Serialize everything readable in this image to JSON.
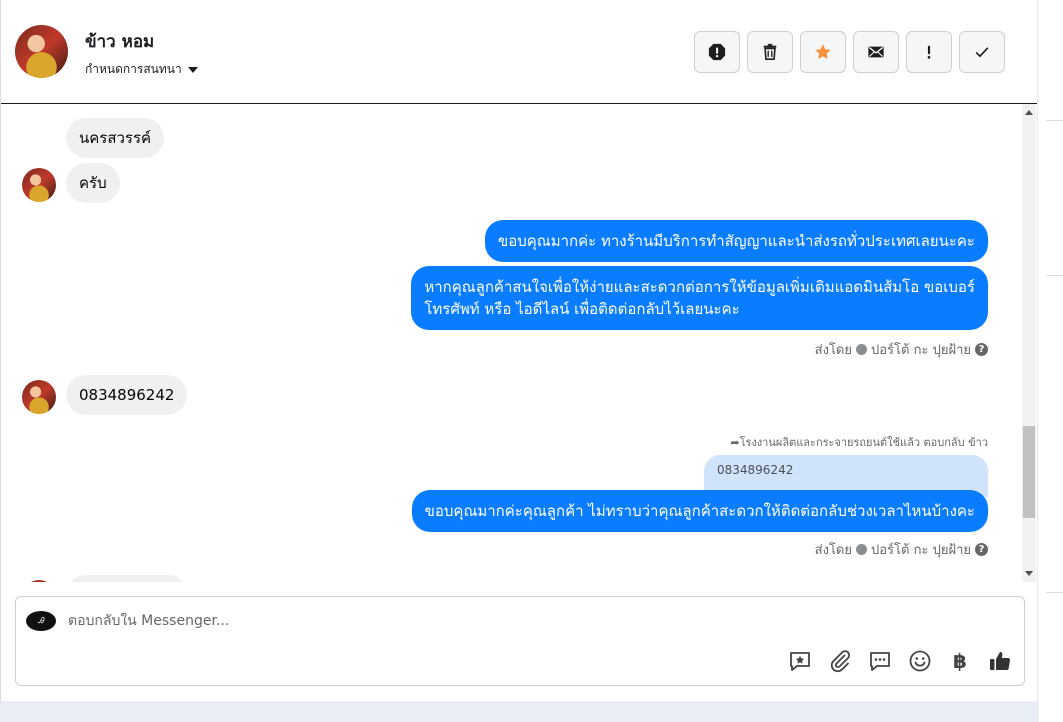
{
  "header": {
    "contact_name": "ข้าว หอม",
    "conversation_settings": "กำหนดการสนทนา",
    "actions": [
      {
        "name": "spam-button",
        "icon": "exclamation-circle-icon"
      },
      {
        "name": "delete-button",
        "icon": "trash-icon"
      },
      {
        "name": "star-button",
        "icon": "star-icon",
        "color": "#f7923b"
      },
      {
        "name": "mark-unread-button",
        "icon": "envelope-icon"
      },
      {
        "name": "follow-up-button",
        "icon": "exclamation-icon"
      },
      {
        "name": "done-button",
        "icon": "check-icon"
      }
    ]
  },
  "messages": {
    "m1": "นครสวรรค์",
    "m2": "ครับ",
    "m3": "ขอบคุณมากค่ะ ทางร้านมีบริการทำสัญญาและนำส่งรถทั่วประเทศเลยนะคะ",
    "m4_line1": "หากคุณลูกค้าสนใจเพื่อให้ง่ายและสะดวกต่อการให้ข้อมูลเพิ่มเติมแอดมินส้มโอ ขอเบอร์",
    "m4_line2": "โทรศัพท์ หรือ ไอดีไลน์ เพื่อติดต่อกลับไว้เลยนะคะ",
    "sent_by_1": "ส่งโดย",
    "sender_1": "ปอร์โต้ กะ ปุยฝ้าย",
    "m5": "0834896242",
    "reply_note": "โรงงานผลิตและกระจายรถยนต์ใช้แล้ว ตอบกลับ ข้าว",
    "quoted": "0834896242",
    "m6": "ขอบคุณมากค่ะคุณลูกค้า ไม่ทราบว่าคุณลูกค้าสะดวกให้ติดต่อกลับช่วงเวลาไหนบ้างคะ",
    "sent_by_2": "ส่งโดย",
    "sender_2": "ปอร์โต้ กะ ปุยฝ้าย"
  },
  "composer": {
    "placeholder": "ตอบกลับใน Messenger...",
    "baht_symbol": "฿",
    "page_logo": "Ꭿ"
  },
  "colors": {
    "outgoing_bubble": "#0a7cff",
    "incoming_bubble": "#f0f0f0",
    "star": "#f7923b"
  }
}
